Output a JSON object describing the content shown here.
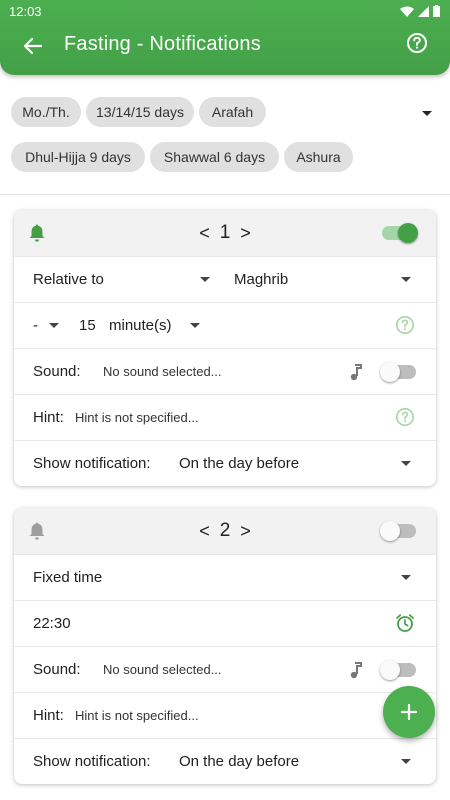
{
  "status_bar": {
    "time": "12:03"
  },
  "app_bar": {
    "title": "Fasting - Notifications"
  },
  "chips": [
    {
      "label": "Mo./Th."
    },
    {
      "label": "13/14/15 days"
    },
    {
      "label": "Arafah"
    },
    {
      "label": "Dhul-Hijja 9 days"
    },
    {
      "label": "Shawwal 6 days"
    },
    {
      "label": "Ashura"
    }
  ],
  "cards": [
    {
      "number": "1",
      "enabled": true,
      "mode": "Relative to",
      "prayer": "Maghrib",
      "sign": "-",
      "amount": "15",
      "unit": "minute(s)",
      "sound_label": "Sound:",
      "sound_value": "No sound selected...",
      "sound_enabled": false,
      "hint_label": "Hint:",
      "hint_value": "Hint is not specified...",
      "show_label": "Show notification:",
      "show_value": "On the day before"
    },
    {
      "number": "2",
      "enabled": false,
      "mode": "Fixed time",
      "time": "22:30",
      "sound_label": "Sound:",
      "sound_value": "No sound selected...",
      "sound_enabled": false,
      "hint_label": "Hint:",
      "hint_value": "Hint is not specified...",
      "show_label": "Show notification:",
      "show_value": "On the day before"
    }
  ],
  "fab": {
    "icon": "plus-icon"
  },
  "colors": {
    "primary": "#4caf50",
    "accent_dark": "#43a047",
    "chip_bg": "#e0e0e0",
    "header_bg": "#f2f2f2"
  },
  "pager": {
    "prev": "<",
    "next": ">"
  }
}
